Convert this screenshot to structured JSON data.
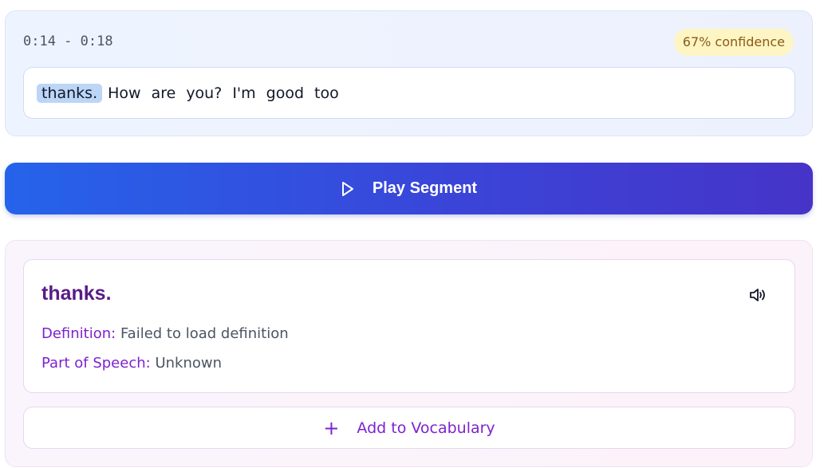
{
  "segment": {
    "time_range": "0:14 - 0:18",
    "confidence": "67% confidence",
    "words": [
      {
        "text": "thanks.",
        "active": true
      },
      {
        "text": "How",
        "active": false
      },
      {
        "text": "are",
        "active": false
      },
      {
        "text": "you?",
        "active": false
      },
      {
        "text": "I'm",
        "active": false
      },
      {
        "text": "good",
        "active": false
      },
      {
        "text": "too",
        "active": false
      }
    ]
  },
  "play_button": {
    "label": "Play Segment",
    "icon": "play-icon"
  },
  "word_detail": {
    "word": "thanks.",
    "speaker_icon": "speaker-icon",
    "definition_label": "Definition:",
    "definition_value": "Failed to load definition",
    "pos_label": "Part of Speech:",
    "pos_value": "Unknown"
  },
  "add_button": {
    "label": "Add to Vocabulary",
    "icon": "plus-icon"
  },
  "colors": {
    "accent_blue": "#2563eb",
    "accent_indigo": "#4634c8",
    "purple_text": "#7e22ce",
    "word_title": "#581c87",
    "highlight": "#bcd6f7",
    "confidence_bg": "#fdf5c4"
  }
}
